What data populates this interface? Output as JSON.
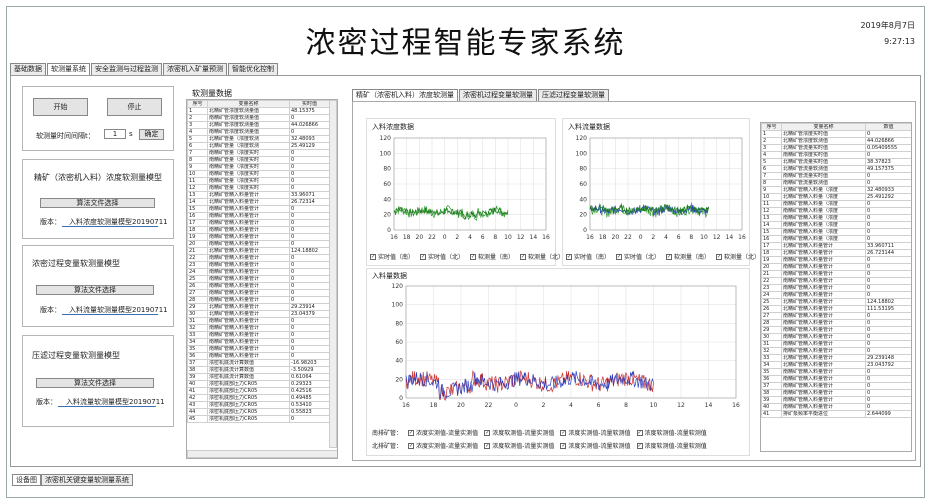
{
  "app_title": "浓密过程智能专家系统",
  "date": "2019年8月7日",
  "time": "9:27:13",
  "tabs": [
    "基础数据",
    "软测量系统",
    "安全监测与过程监测",
    "浓密机入矿量预测",
    "智能优化控制"
  ],
  "active_tab": 1,
  "bottom_tabs": [
    "设备图",
    "浓密机关键变量软测量系统"
  ],
  "left": {
    "start": "开始",
    "stop": "停止",
    "interval_label": "软测量时间间隔t：",
    "interval_value": "1",
    "interval_unit": "s",
    "confirm": "确定",
    "sections": [
      {
        "title": "精矿（浓密机入料）浓度软测量模型",
        "select": "算法文件选择",
        "version_label": "版本：",
        "version": "入料浓度软测量模型20190711"
      },
      {
        "title": "浓密过程变量软测量模型",
        "select": "算法文件选择",
        "version_label": "版本：",
        "version": "入料流量软测量模型20190711"
      },
      {
        "title": "压滤过程变量软测量模型",
        "select": "算法文件选择",
        "version_label": "版本：",
        "version": "入料流量软测量模型20190711"
      }
    ]
  },
  "soft_table": {
    "title": "软测量数据",
    "headers": [
      "序号",
      "变量名称",
      "实时值"
    ],
    "rows": [
      [
        "1",
        "北精矿管浓度软测量值",
        "48.15375"
      ],
      [
        "2",
        "南精矿管浓度软测量值",
        "0"
      ],
      [
        "3",
        "北精矿管浓度软测量值",
        "44.026866"
      ],
      [
        "4",
        "南精矿管浓度软测量值",
        "0"
      ],
      [
        "5",
        "北精矿管量（浓度软测",
        "32.48093"
      ],
      [
        "6",
        "北精矿管量（浓度软测",
        "25.49129"
      ],
      [
        "7",
        "南精矿管量（浓度实时",
        "0"
      ],
      [
        "8",
        "南精矿管量（浓度实时",
        "0"
      ],
      [
        "9",
        "南精矿管量（浓度实时",
        "0"
      ],
      [
        "10",
        "南精矿管量（浓度实时",
        "0"
      ],
      [
        "11",
        "南精矿管量（浓度实时",
        "0"
      ],
      [
        "12",
        "南精矿管量（浓度实时",
        "0"
      ],
      [
        "13",
        "北精矿管精入料量管计",
        "33.96071"
      ],
      [
        "14",
        "北精矿管精入料量管计",
        "26.72314"
      ],
      [
        "15",
        "南精矿管精入料量管计",
        "0"
      ],
      [
        "16",
        "南精矿管精入料量管计",
        "0"
      ],
      [
        "17",
        "南精矿管精入料量管计",
        "0"
      ],
      [
        "18",
        "南精矿管精入料量管计",
        "0"
      ],
      [
        "19",
        "南精矿管精入料量管计",
        "0"
      ],
      [
        "20",
        "南精矿管精入料量管计",
        "0"
      ],
      [
        "21",
        "北精矿管精入料量管计",
        "124.18802"
      ],
      [
        "22",
        "南精矿管精入料量管计",
        "0"
      ],
      [
        "23",
        "南精矿管精入料量管计",
        "0"
      ],
      [
        "24",
        "南精矿管精入料量管计",
        "0"
      ],
      [
        "25",
        "南精矿管精入料量管计",
        "0"
      ],
      [
        "26",
        "南精矿管精入料量管计",
        "0"
      ],
      [
        "27",
        "南精矿管精入料量管计",
        "0"
      ],
      [
        "28",
        "南精矿管精入料量管计",
        "0"
      ],
      [
        "29",
        "北精矿管精入料量管计",
        "29.23914"
      ],
      [
        "30",
        "北精矿管精入料量管计",
        "23.04379"
      ],
      [
        "31",
        "南精矿管精入料量管计",
        "0"
      ],
      [
        "32",
        "南精矿管精入料量管计",
        "0"
      ],
      [
        "33",
        "南精矿管精入料量管计",
        "0"
      ],
      [
        "34",
        "南精矿管精入料量管计",
        "0"
      ],
      [
        "35",
        "南精矿管精入料量管计",
        "0"
      ],
      [
        "36",
        "南精矿管精入料量管计",
        "0"
      ],
      [
        "37",
        "浓密机底流计算数值",
        "-16.98203"
      ],
      [
        "38",
        "浓密机底流计算数值",
        "-3.50929"
      ],
      [
        "39",
        "浓密机底流计算数值",
        "0.61064"
      ],
      [
        "40",
        "浓密机底部压力CR05",
        "0.29323"
      ],
      [
        "41",
        "浓密机底部压力CR05",
        "0.42516"
      ],
      [
        "42",
        "浓密机底部压力CR05",
        "0.49485"
      ],
      [
        "43",
        "浓密机底部压力CR05",
        "0.53410"
      ],
      [
        "44",
        "浓密机底部压力CR05",
        "0.55823"
      ],
      [
        "45",
        "浓密机底部压力CR05",
        "0"
      ]
    ]
  },
  "chart_tabs": [
    "精矿（浓密机入料）浓度软测量",
    "浓密机过程变量软测量",
    "压滤过程变量软测量"
  ],
  "right_table": {
    "headers": [
      "序号",
      "变量名称",
      "数值"
    ],
    "rows": [
      [
        "1",
        "北精矿管浓度实时值",
        "0"
      ],
      [
        "2",
        "北精矿管浓度软测值",
        "44.026866"
      ],
      [
        "3",
        "北精矿管流量实时值",
        "0.05409555"
      ],
      [
        "4",
        "南精矿管浓度实时值",
        "0"
      ],
      [
        "5",
        "北精矿管流量实时值",
        "38.37823"
      ],
      [
        "6",
        "北精矿管流量软测值",
        "49.157375"
      ],
      [
        "7",
        "南精矿管流量实时值",
        "0"
      ],
      [
        "8",
        "南精矿管流量软测值",
        "0"
      ],
      [
        "9",
        "北精矿管精入料量（浓度",
        "32.480933"
      ],
      [
        "10",
        "北精矿管精入料量（浓度",
        "25.491292"
      ],
      [
        "11",
        "南精矿管精入料量（浓度",
        "0"
      ],
      [
        "12",
        "南精矿管精入料量（浓度",
        "0"
      ],
      [
        "13",
        "南精矿管精入料量（浓度",
        "0"
      ],
      [
        "14",
        "南精矿管精入料量（浓度",
        "0"
      ],
      [
        "15",
        "南精矿管精入料量（浓度",
        "0"
      ],
      [
        "16",
        "南精矿管精入料量（浓度",
        "0"
      ],
      [
        "17",
        "北精矿管精入料量管计",
        "33.960711"
      ],
      [
        "18",
        "北精矿管精入料量管计",
        "26.723144"
      ],
      [
        "19",
        "南精矿管精入料量管计",
        "0"
      ],
      [
        "20",
        "南精矿管精入料量管计",
        "0"
      ],
      [
        "21",
        "南精矿管精入料量管计",
        "0"
      ],
      [
        "22",
        "南精矿管精入料量管计",
        "0"
      ],
      [
        "23",
        "南精矿管精入料量管计",
        "0"
      ],
      [
        "24",
        "南精矿管精入料量管计",
        "0"
      ],
      [
        "25",
        "北精矿管精入料量管计",
        "124.18802"
      ],
      [
        "26",
        "北精矿管精入料量管计",
        "111.53195"
      ],
      [
        "27",
        "南精矿管精入料量管计",
        "0"
      ],
      [
        "28",
        "南精矿管精入料量管计",
        "0"
      ],
      [
        "29",
        "南精矿管精入料量管计",
        "0"
      ],
      [
        "30",
        "南精矿管精入料量管计",
        "0"
      ],
      [
        "31",
        "南精矿管精入料量管计",
        "0"
      ],
      [
        "32",
        "南精矿管精入料量管计",
        "0"
      ],
      [
        "33",
        "北精矿管精入料量管计",
        "29.239148"
      ],
      [
        "34",
        "北精矿管精入料量管计",
        "23.043792"
      ],
      [
        "35",
        "南精矿管精入料量管计",
        "0"
      ],
      [
        "36",
        "南精矿管精入料量管计",
        "0"
      ],
      [
        "37",
        "南精矿管精入料量管计",
        "0"
      ],
      [
        "38",
        "南精矿管精入料量管计",
        "0"
      ],
      [
        "39",
        "南精矿管精入料量管计",
        "0"
      ],
      [
        "40",
        "南精矿管精入料量管计",
        "0"
      ],
      [
        "41",
        "排矿泵频率平衡进位",
        "2.644099"
      ]
    ]
  },
  "chart_data": [
    {
      "type": "line",
      "title": "入料浓度数据",
      "x_ticks": [
        "16",
        "18",
        "20",
        "22",
        "0",
        "2",
        "4",
        "6",
        "8",
        "10",
        "12",
        "14",
        "16"
      ],
      "y_ticks": [
        "0",
        "20",
        "40",
        "60",
        "80",
        "100",
        "120"
      ],
      "ylim": [
        0,
        120
      ],
      "legend": [
        "实时值（南）",
        "实时值（北）",
        "软测量（南）",
        "软测量（北）"
      ],
      "series_colors": [
        "#2c9a2c",
        "#2a3fc0",
        "#c83030",
        "#1a7a1a"
      ]
    },
    {
      "type": "line",
      "title": "入料流量数据",
      "x_ticks": [
        "16",
        "18",
        "20",
        "22",
        "0",
        "2",
        "4",
        "6",
        "8",
        "10",
        "12",
        "14",
        "16"
      ],
      "y_ticks": [
        "0",
        "20",
        "40",
        "60",
        "80",
        "100",
        "120"
      ],
      "ylim": [
        0,
        120
      ],
      "legend": [
        "实时值（南）",
        "实时值（北）",
        "软测量（南）",
        "软测量（北）"
      ],
      "series_colors": [
        "#2c9a2c",
        "#2a3fc0",
        "#c83030",
        "#1a7a1a"
      ]
    },
    {
      "type": "line",
      "title": "入料量数据",
      "x_ticks": [
        "16",
        "18",
        "20",
        "22",
        "0",
        "2",
        "4",
        "6",
        "8",
        "10",
        "12",
        "14",
        "16"
      ],
      "y_ticks": [
        "0",
        "20",
        "40",
        "60",
        "80",
        "100",
        "120"
      ],
      "ylim": [
        0,
        120
      ],
      "legend_rows": [
        {
          "label": "南排矿管：",
          "items": [
            "浓度实测值-流量实测值",
            "浓度软测值-流量实测值",
            "浓度实测值-流量软测值",
            "浓度软测值-流量软测值"
          ]
        },
        {
          "label": "北排矿管：",
          "items": [
            "浓度实测值-流量实测值",
            "浓度软测值-流量实测值",
            "浓度实测值-流量软测值",
            "浓度软测值-流量软测值"
          ]
        }
      ],
      "series_colors": [
        "#2a3fc0",
        "#c83030"
      ]
    }
  ]
}
